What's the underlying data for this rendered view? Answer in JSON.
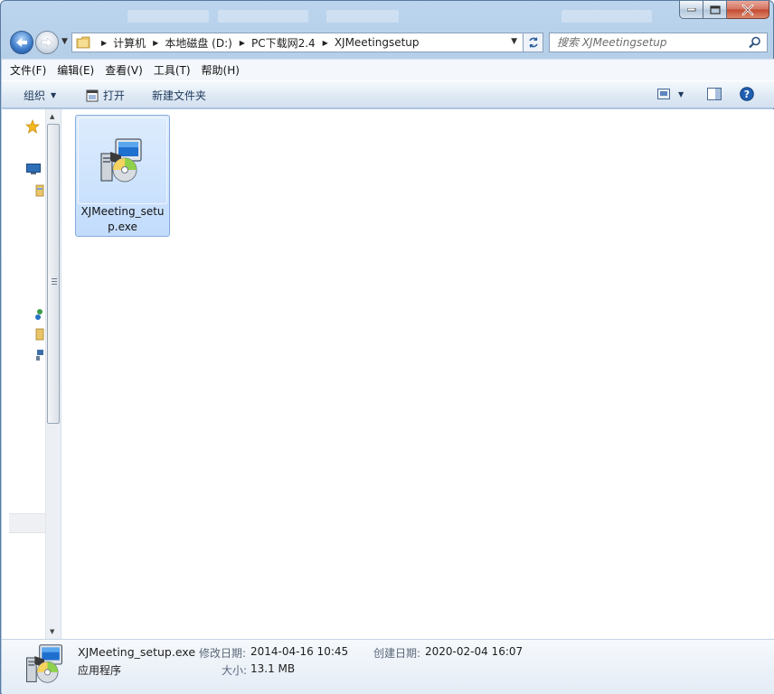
{
  "window": {
    "controls": {
      "minimize": "minimize",
      "maximize": "maximize",
      "close": "close"
    }
  },
  "address": {
    "crumbs": [
      "计算机",
      "本地磁盘 (D:)",
      "PC下载网2.4",
      "XJMeetingsetup"
    ]
  },
  "search": {
    "placeholder": "搜索 XJMeetingsetup"
  },
  "menu": {
    "items": [
      "文件(F)",
      "编辑(E)",
      "查看(V)",
      "工具(T)",
      "帮助(H)"
    ]
  },
  "toolbar": {
    "organize": "组织",
    "open": "打开",
    "new_folder": "新建文件夹"
  },
  "files": [
    {
      "name": "XJMeeting_setup.exe",
      "icon": "installer-icon",
      "selected": true
    }
  ],
  "details": {
    "name": "XJMeeting_setup.exe",
    "type": "应用程序",
    "modified_label": "修改日期:",
    "modified_value": "2014-04-16 10:45",
    "created_label": "创建日期:",
    "created_value": "2020-02-04 16:07",
    "size_label": "大小:",
    "size_value": "13.1 MB"
  },
  "colors": {
    "accent": "#3a78c6",
    "selection": "#cce1fd",
    "toolbar_text": "#1e395b"
  }
}
